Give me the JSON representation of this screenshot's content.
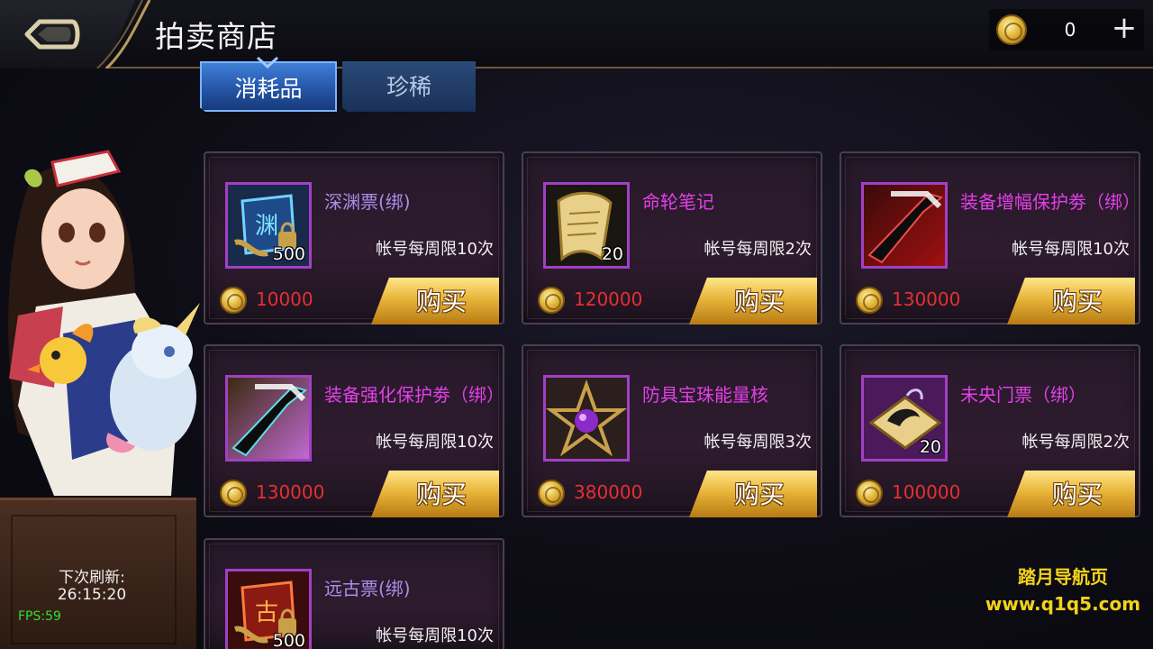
{
  "header": {
    "title": "拍卖商店",
    "currency_value": "0",
    "add_label": "+"
  },
  "tabs": [
    {
      "label": "消耗品",
      "active": true
    },
    {
      "label": "珍稀",
      "active": false
    }
  ],
  "refresh": {
    "label": "下次刷新:",
    "time": "26:15:20"
  },
  "fps": "FPS:59",
  "items": [
    {
      "name": "深渊票(绑)",
      "limit": "帐号每周限10次",
      "price": "10000",
      "qty": "500",
      "icon": "abyss-ticket-icon",
      "buy_label": "购买"
    },
    {
      "name": "命轮笔记",
      "limit": "帐号每周限2次",
      "price": "120000",
      "qty": "20",
      "icon": "scroll-note-icon",
      "buy_label": "购买"
    },
    {
      "name": "装备增幅保护劵（绑）",
      "limit": "帐号每周限10次",
      "price": "130000",
      "qty": "",
      "icon": "amplify-protect-icon",
      "buy_label": "购买"
    },
    {
      "name": "装备强化保护劵（绑）",
      "limit": "帐号每周限10次",
      "price": "130000",
      "qty": "",
      "icon": "enhance-protect-icon",
      "buy_label": "购买"
    },
    {
      "name": "防具宝珠能量核",
      "limit": "帐号每周限3次",
      "price": "380000",
      "qty": "",
      "icon": "star-orb-icon",
      "buy_label": "购买"
    },
    {
      "name": "未央门票（绑）",
      "limit": "帐号每周限2次",
      "price": "100000",
      "qty": "20",
      "icon": "weiyang-ticket-icon",
      "buy_label": "购买"
    },
    {
      "name": "远古票(绑)",
      "limit": "帐号每周限10次",
      "price": "",
      "qty": "500",
      "icon": "ancient-ticket-icon",
      "buy_label": ""
    }
  ],
  "watermark": {
    "title": "踏月导航页",
    "url": "www.q1q5.com"
  },
  "colors": {
    "accent_gold": "#e8b53a",
    "item_name_magenta": "#e43fe8",
    "item_name_lilac": "#a88ee8",
    "price_red": "#e53030",
    "tab_active_blue": "#2f6bc4"
  }
}
